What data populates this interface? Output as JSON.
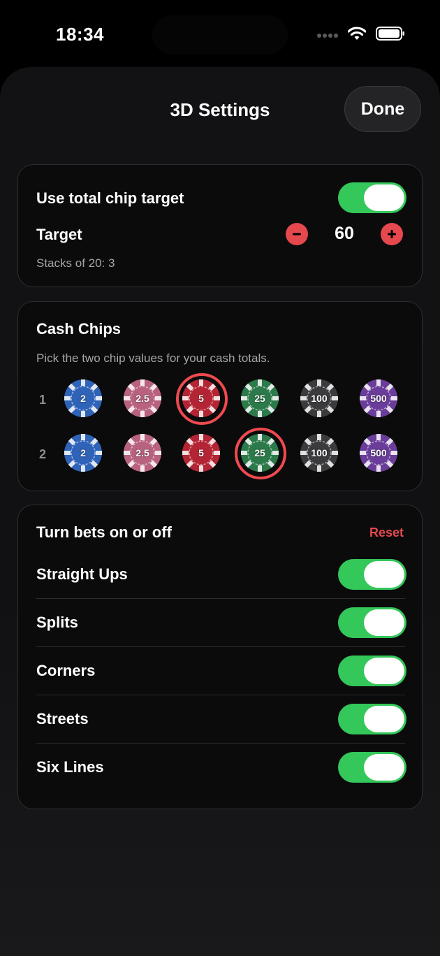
{
  "status": {
    "time": "18:34"
  },
  "header": {
    "title": "3D Settings",
    "done_label": "Done"
  },
  "target_card": {
    "use_total_label": "Use total chip target",
    "use_total_on": true,
    "target_label": "Target",
    "target_value": "60",
    "stacks_text": "Stacks of 20: 3"
  },
  "cash_chips": {
    "title": "Cash Chips",
    "subtitle": "Pick the two chip values for your cash totals.",
    "rows": [
      {
        "label": "1",
        "selected": "5"
      },
      {
        "label": "2",
        "selected": "25"
      }
    ],
    "chips": [
      {
        "value": "2",
        "color": "#2f63b8"
      },
      {
        "value": "2.5",
        "color": "#b8627f"
      },
      {
        "value": "5",
        "color": "#b32534"
      },
      {
        "value": "25",
        "color": "#2c7a4a"
      },
      {
        "value": "100",
        "color": "#3b3b3d"
      },
      {
        "value": "500",
        "color": "#6a3d9a"
      }
    ]
  },
  "bets": {
    "title": "Turn bets on or off",
    "reset_label": "Reset",
    "items": [
      {
        "label": "Straight Ups",
        "on": true
      },
      {
        "label": "Splits",
        "on": true
      },
      {
        "label": "Corners",
        "on": true
      },
      {
        "label": "Streets",
        "on": true
      },
      {
        "label": "Six Lines",
        "on": true
      }
    ]
  },
  "colors": {
    "accent_green": "#34c759",
    "accent_red": "#e5484d"
  }
}
